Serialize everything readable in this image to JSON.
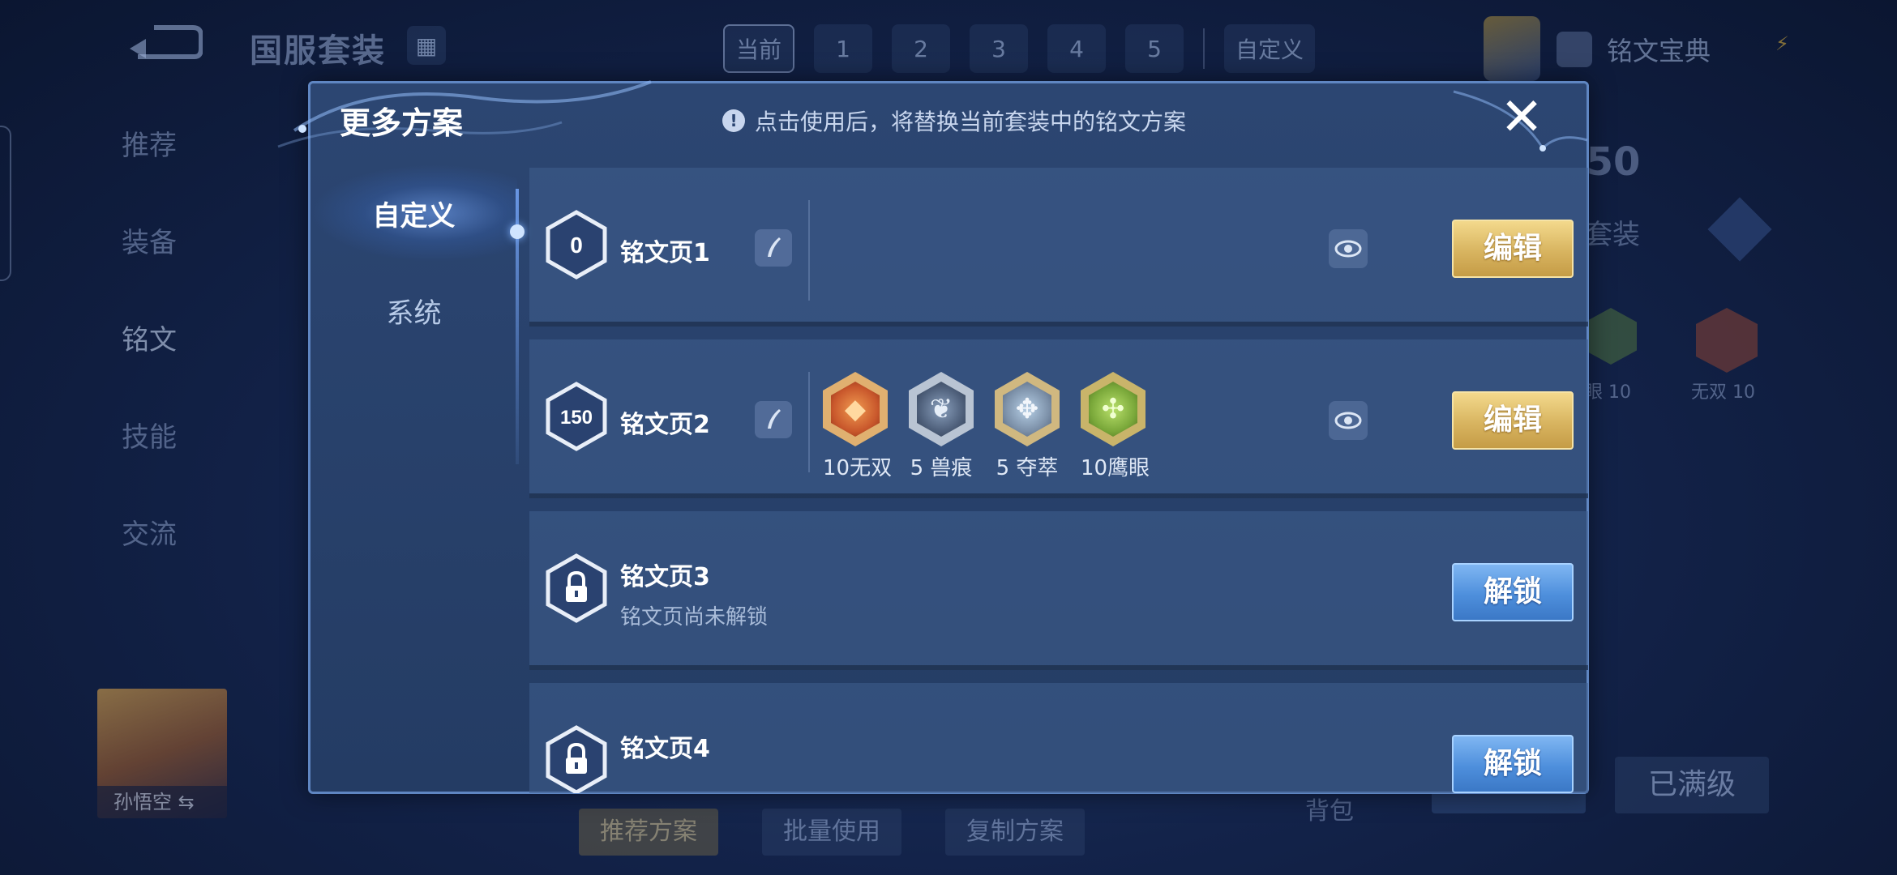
{
  "topbar": {
    "suit_title": "国服套装",
    "tabs": [
      "当前",
      "1",
      "2",
      "3",
      "4",
      "5",
      "自定义"
    ],
    "codex_label": "铭文宝典"
  },
  "leftnav": {
    "items": [
      "推荐",
      "装备",
      "铭文",
      "技能",
      "交流"
    ]
  },
  "background": {
    "score": "50",
    "suit_label": "套装",
    "rune_label_1": "眼 10",
    "rune_label_2": "无双 10",
    "hero_name": "孙悟空",
    "bottom_buttons": [
      "推荐方案",
      "批量使用",
      "复制方案"
    ],
    "bag_label": "背包",
    "max_level_label": "已满级"
  },
  "dialog": {
    "title": "更多方案",
    "notice": "点击使用后，将替换当前套装中的铭文方案",
    "close_symbol": "✕",
    "side_tabs": [
      {
        "label": "自定义",
        "active": true
      },
      {
        "label": "系统",
        "active": false
      }
    ],
    "pages": [
      {
        "name": "铭文页1",
        "level": "0",
        "locked": false,
        "button": "编辑",
        "runes": []
      },
      {
        "name": "铭文页2",
        "level": "150",
        "locked": false,
        "button": "编辑",
        "runes": [
          {
            "label": "10无双",
            "color": "#c9582c",
            "icon": "diamond-rune-icon"
          },
          {
            "label": "5 兽痕",
            "color": "#5f6f88",
            "icon": "claw-rune-icon"
          },
          {
            "label": "5 夺萃",
            "color": "#7c90a8",
            "icon": "knot-rune-icon"
          },
          {
            "label": "10鹰眼",
            "color": "#7aa83a",
            "icon": "clover-rune-icon"
          }
        ]
      },
      {
        "name": "铭文页3",
        "locked": true,
        "sub": "铭文页尚未解锁",
        "button": "解锁"
      },
      {
        "name": "铭文页4",
        "locked": true,
        "sub": "",
        "button": "解锁"
      }
    ]
  },
  "colors": {
    "gold_button": "#d8b460",
    "blue_button": "#4e8fdc",
    "dialog_bg": "#2c4672",
    "dialog_border": "#5f86c2"
  }
}
